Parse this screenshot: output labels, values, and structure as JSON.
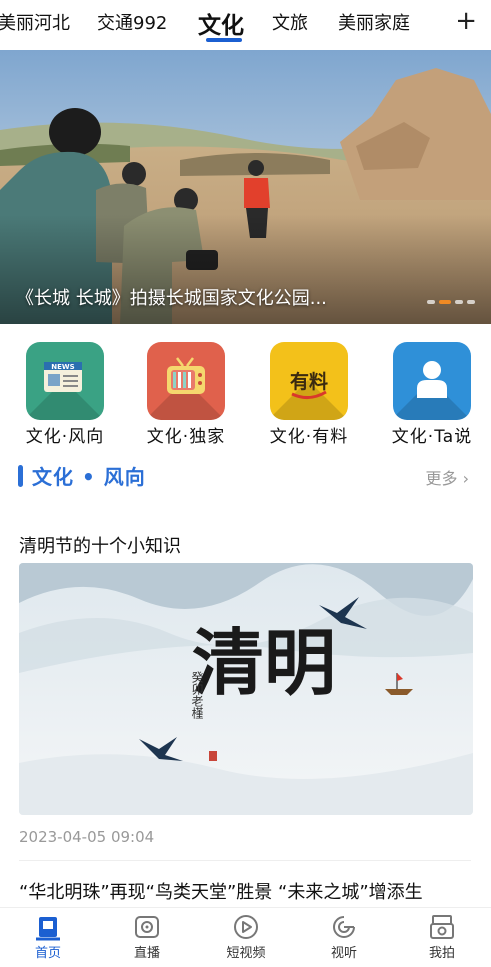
{
  "tabs": [
    {
      "label": "美丽河北",
      "active": false
    },
    {
      "label": "交通992",
      "active": false
    },
    {
      "label": "文化",
      "active": true
    },
    {
      "label": "文旅",
      "active": false
    },
    {
      "label": "美丽家庭",
      "active": false
    }
  ],
  "tabs_add_icon": "plus-icon",
  "banner": {
    "caption": "《长城 长城》拍摄长城国家文化公园...",
    "slide_count": 4,
    "active_slide": 2
  },
  "quick_entries": [
    {
      "label": "文化·风向",
      "icon": "news-icon",
      "color": "#3aa284"
    },
    {
      "label": "文化·独家",
      "icon": "tv-icon",
      "color": "#e0614c"
    },
    {
      "label": "文化·有料",
      "icon": "youliao-icon",
      "color": "#f3c11a",
      "icon_text": "有料"
    },
    {
      "label": "文化·Ta说",
      "icon": "person-icon",
      "color": "#2f90d8"
    }
  ],
  "section": {
    "title": "文化 • 风向",
    "more": "更多 ›"
  },
  "article": {
    "title": "清明节的十个小知识",
    "image_calligraphy": "清明",
    "image_inscription": "癸卯老槿",
    "time": "2023-04-05 09:04"
  },
  "article2": {
    "title": "“华北明珠”再现“鸟类天堂”胜景 “未来之城”增添生"
  },
  "bottom_nav": [
    {
      "label": "首页",
      "icon": "home-icon",
      "active": true
    },
    {
      "label": "直播",
      "icon": "live-icon",
      "active": false
    },
    {
      "label": "短视频",
      "icon": "play-icon",
      "active": false
    },
    {
      "label": "视听",
      "icon": "audio-icon",
      "active": false
    },
    {
      "label": "我拍",
      "icon": "camera-icon",
      "active": false
    }
  ],
  "colors": {
    "accent": "#1b5fd1",
    "section": "#2b6fd6",
    "dot_active": "#f08a24"
  }
}
